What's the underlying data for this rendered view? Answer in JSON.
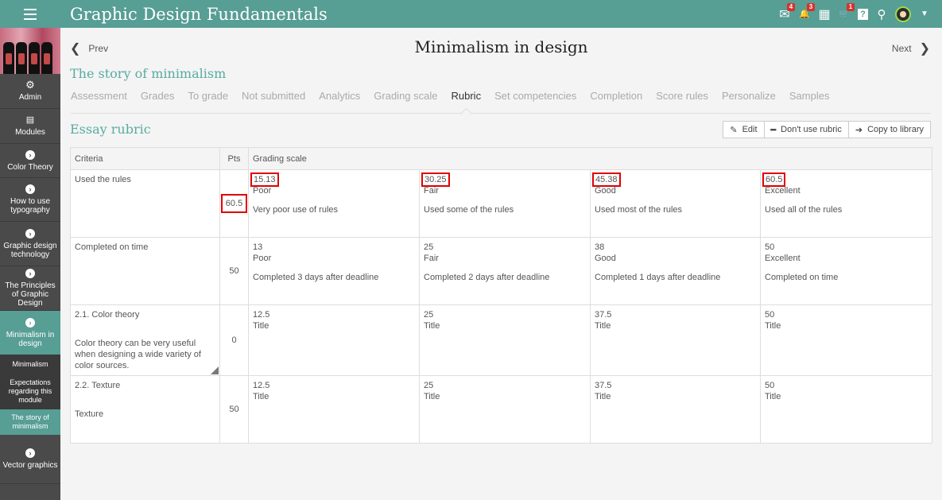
{
  "app": {
    "title": "Graphic Design Fundamentals"
  },
  "topbar": {
    "icons": [
      {
        "name": "messages-icon",
        "glyph": "✉",
        "badge": "4"
      },
      {
        "name": "notifications-icon",
        "glyph": "🔔",
        "badge": "3"
      },
      {
        "name": "calendar-icon",
        "glyph": "▦",
        "badge": ""
      },
      {
        "name": "cart-icon",
        "glyph": "🛒",
        "badge": "1"
      },
      {
        "name": "help-icon",
        "glyph": "?",
        "badge": ""
      },
      {
        "name": "search-icon",
        "glyph": "⚲",
        "badge": ""
      }
    ]
  },
  "sidebar": {
    "items": [
      {
        "label": "Admin",
        "icon": "gear-icon"
      },
      {
        "label": "Modules",
        "icon": "modules-icon"
      },
      {
        "label": "Color Theory",
        "icon": "chevron-right-icon"
      },
      {
        "label": "How to use typography",
        "icon": "chevron-right-icon"
      },
      {
        "label": "Graphic design technology",
        "icon": "chevron-right-icon"
      },
      {
        "label": "The Principles of Graphic Design",
        "icon": "chevron-right-icon"
      },
      {
        "label": "Minimalism in design",
        "icon": "chevron-right-icon"
      }
    ],
    "subitems": [
      "Minimalism",
      "Expectations regarding this module",
      "The story of minimalism"
    ],
    "last": {
      "label": "Vector graphics"
    }
  },
  "nav": {
    "prev": "Prev",
    "next": "Next"
  },
  "page_title": "Minimalism in design",
  "section_title": "The story of minimalism",
  "tabs": [
    "Assessment",
    "Grades",
    "To grade",
    "Not submitted",
    "Analytics",
    "Grading scale",
    "Rubric",
    "Set competencies",
    "Completion",
    "Score rules",
    "Personalize",
    "Samples"
  ],
  "active_tab": "Rubric",
  "rubric": {
    "title": "Essay rubric",
    "actions": {
      "edit": "Edit",
      "dont_use": "Don't use rubric",
      "copy": "Copy to library"
    },
    "headers": {
      "criteria": "Criteria",
      "pts": "Pts",
      "scale": "Grading scale"
    },
    "rows": [
      {
        "criteria": "Used the rules",
        "criteria_desc": "",
        "pts": "60.5",
        "cells": [
          {
            "score": "15.13",
            "label": "Poor",
            "desc": "Very poor use of rules"
          },
          {
            "score": "30.25",
            "label": "Fair",
            "desc": "Used some of the rules"
          },
          {
            "score": "45.38",
            "label": "Good",
            "desc": "Used most of the rules"
          },
          {
            "score": "60.5",
            "label": "Excellent",
            "desc": "Used all of the rules"
          }
        ]
      },
      {
        "criteria": "Completed on time",
        "criteria_desc": "",
        "pts": "50",
        "cells": [
          {
            "score": "13",
            "label": "Poor",
            "desc": "Completed 3 days after deadline"
          },
          {
            "score": "25",
            "label": "Fair",
            "desc": "Completed 2 days after deadline"
          },
          {
            "score": "38",
            "label": "Good",
            "desc": "Completed 1 days after deadline"
          },
          {
            "score": "50",
            "label": "Excellent",
            "desc": "Completed on time"
          }
        ]
      },
      {
        "criteria": "2.1. Color theory",
        "criteria_desc": "Color theory can be very useful when designing a wide variety of color sources.",
        "pts": "0",
        "cells": [
          {
            "score": "12.5",
            "label": "Title",
            "desc": ""
          },
          {
            "score": "25",
            "label": "Title",
            "desc": ""
          },
          {
            "score": "37.5",
            "label": "Title",
            "desc": ""
          },
          {
            "score": "50",
            "label": "Title",
            "desc": ""
          }
        ]
      },
      {
        "criteria": "2.2. Texture",
        "criteria_desc": "Texture",
        "pts": "50",
        "cells": [
          {
            "score": "12.5",
            "label": "Title",
            "desc": ""
          },
          {
            "score": "25",
            "label": "Title",
            "desc": ""
          },
          {
            "score": "37.5",
            "label": "Title",
            "desc": ""
          },
          {
            "score": "50",
            "label": "Title",
            "desc": ""
          }
        ]
      }
    ]
  },
  "colors": {
    "accent": "#579e95",
    "sidebar": "#4a4a4a",
    "highlight": "#e00000"
  }
}
